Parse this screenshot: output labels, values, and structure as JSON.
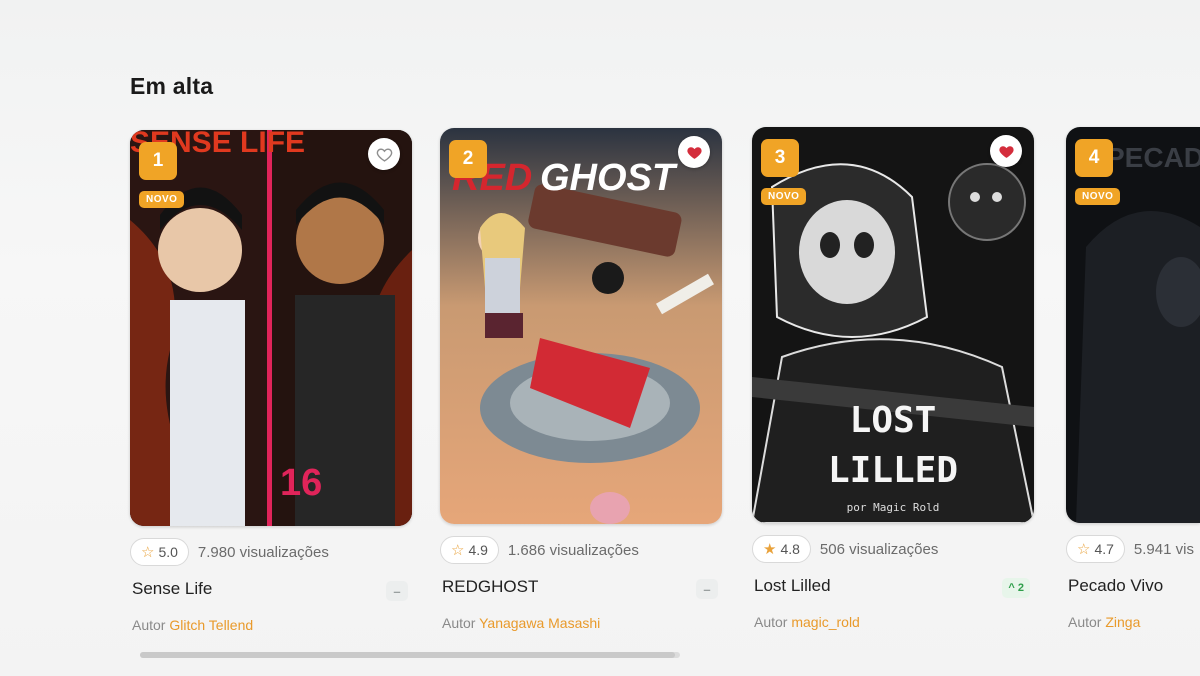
{
  "section": {
    "title": "Em alta"
  },
  "badge_new": "NOVO",
  "cards": [
    {
      "rank": "1",
      "is_new": true,
      "favorited": false,
      "rating": "5.0",
      "rating_star": "outline",
      "views": "7.980 visualizações",
      "title": "Sense Life",
      "author_label": "Autor",
      "author": "Glitch Tellend",
      "trend": "–",
      "cover_text": "SENSE LIFE",
      "cover_number": "16"
    },
    {
      "rank": "2",
      "is_new": false,
      "favorited": true,
      "rating": "4.9",
      "rating_star": "outline",
      "views": "1.686 visualizações",
      "title": "REDGHOST",
      "author_label": "Autor",
      "author": "Yanagawa Masashi",
      "trend": "–",
      "cover_text_red": "RED",
      "cover_text_white": "GHOST"
    },
    {
      "rank": "3",
      "is_new": true,
      "favorited": true,
      "rating": "4.8",
      "rating_star": "filled",
      "views": "506 visualizações",
      "title": "Lost Lilled",
      "author_label": "Autor",
      "author": "magic_rold",
      "trend": "^ 2",
      "cover_text_1": "LOST",
      "cover_text_2": "LILLED",
      "cover_byline": "por Magic Rold"
    },
    {
      "rank": "4",
      "is_new": true,
      "favorited": false,
      "rating": "4.7",
      "rating_star": "outline",
      "views": "5.941 vis",
      "title": "Pecado Vivo",
      "author_label": "Autor",
      "author": "Zinga",
      "cover_text": "PECADO"
    }
  ],
  "colors": {
    "accent": "#f0a426",
    "author_link": "#e99a2b",
    "heart": "#d42d3c",
    "trend_up": "#2e9e4a"
  }
}
